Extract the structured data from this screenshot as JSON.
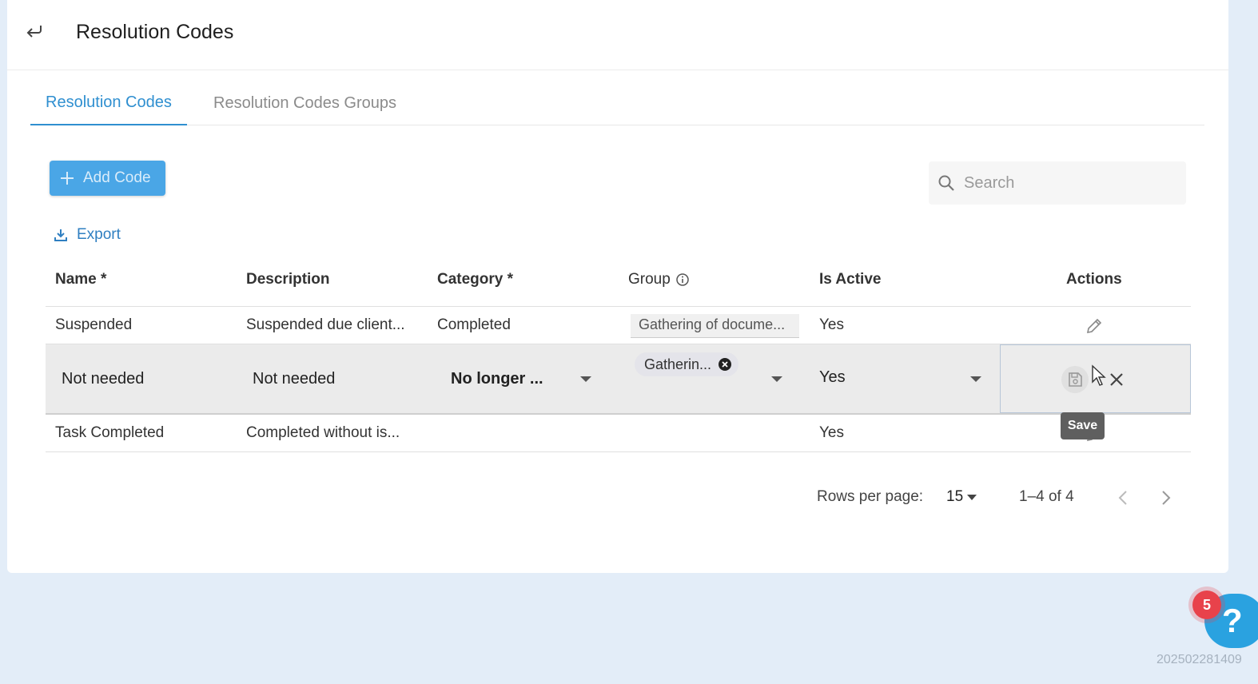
{
  "header": {
    "title": "Resolution Codes",
    "back_icon": "back-arrow-icon"
  },
  "tabs": [
    {
      "label": "Resolution Codes",
      "active": true
    },
    {
      "label": "Resolution Codes Groups",
      "active": false
    }
  ],
  "toolbar": {
    "add_label": "Add Code",
    "search_placeholder": "Search",
    "export_label": "Export"
  },
  "table": {
    "columns": [
      "Name *",
      "Description",
      "Category *",
      "Group",
      "Is Active",
      "Actions"
    ],
    "rows": [
      {
        "name": "Suspended",
        "description": "Suspended due client...",
        "category": "Completed",
        "group": "Gathering of docume...",
        "is_active": "Yes"
      },
      {
        "name": "Not needed",
        "description": "Not needed",
        "category": "No longer ...",
        "group": "Gatherin...",
        "is_active": "Yes",
        "editing": true
      },
      {
        "name": "Task Completed",
        "description": "Completed without is...",
        "category": "",
        "group": "",
        "is_active": "Yes"
      }
    ],
    "tooltip": "Save"
  },
  "pagination": {
    "rows_per_page_label": "Rows per page:",
    "rows_per_page": "15",
    "range": "1–4 of 4"
  },
  "help": {
    "badge_count": "5",
    "icon": "?"
  },
  "version": "202502281409",
  "colors": {
    "accent": "#2f8fd0",
    "add_button": "#4aa6e6",
    "badge": "#e8424b",
    "help": "#2aa2e0",
    "background": "#e3edf8"
  }
}
